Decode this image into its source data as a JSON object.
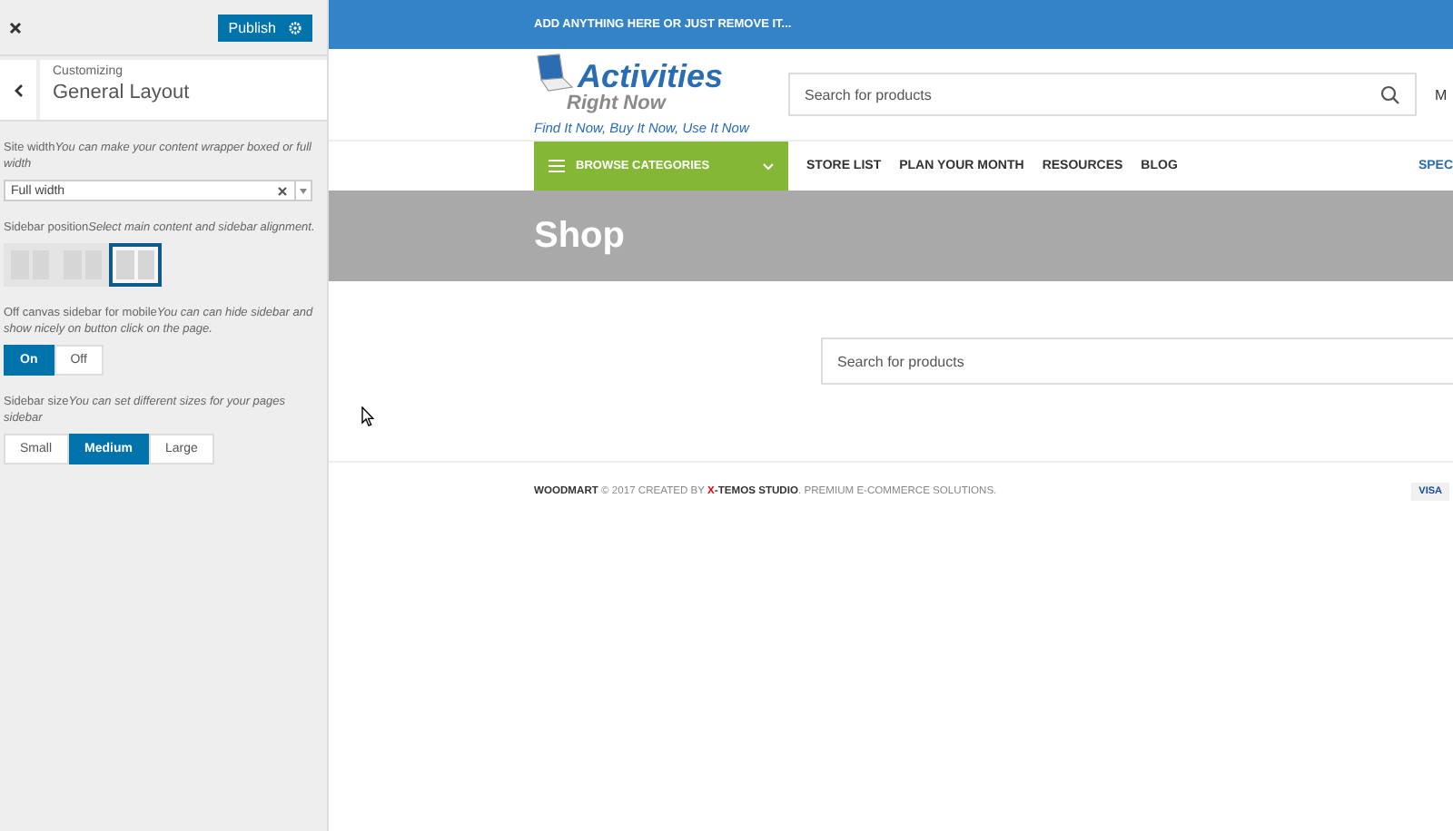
{
  "customizer": {
    "publish": "Publish",
    "breadcrumb": "Customizing",
    "title": "General Layout",
    "controls": [
      {
        "kind": "select",
        "label": "Site width",
        "hint": "You can make your content wrapper boxed or full width",
        "value": "Full width"
      },
      {
        "kind": "images",
        "label": "Sidebar position",
        "hint": "Select main content and sidebar alignment.",
        "options": [
          {
            "selected": false
          },
          {
            "selected": false
          },
          {
            "selected": true
          }
        ]
      },
      {
        "kind": "buttons",
        "label": "Off canvas sidebar for mobile",
        "hint": "You can can hide sidebar and show nicely on button click on the page.",
        "options": [
          {
            "label": "On",
            "selected": true
          },
          {
            "label": "Off",
            "selected": false
          }
        ]
      },
      {
        "kind": "buttons",
        "label": "Sidebar size",
        "hint": "You can set different sizes for your pages sidebar",
        "options": [
          {
            "label": "Small",
            "selected": false
          },
          {
            "label": "Medium",
            "selected": true
          },
          {
            "label": "Large",
            "selected": false
          }
        ]
      }
    ]
  },
  "preview": {
    "topbar": "ADD ANYTHING HERE OR JUST REMOVE IT...",
    "logo": {
      "line1": "Activities",
      "line2": "Right Now",
      "tagline": "Find It Now, Buy It Now, Use It Now"
    },
    "search_placeholder": "Search for products",
    "header_cut": "M",
    "browse": "BROWSE CATEGORIES",
    "nav": [
      "STORE LIST",
      "PLAN YOUR MONTH",
      "RESOURCES",
      "BLOG"
    ],
    "nav_cut": "SPEC",
    "page_title": "Shop",
    "content_search_placeholder": "Search for products",
    "footer": {
      "before": "**WOODMART** © 2017 CREATED BY ",
      "studio": "X-TEMOS STUDIO",
      "after": ". PREMIUM E-COMMERCE SOLUTIONS.",
      "card": "VISA"
    }
  }
}
